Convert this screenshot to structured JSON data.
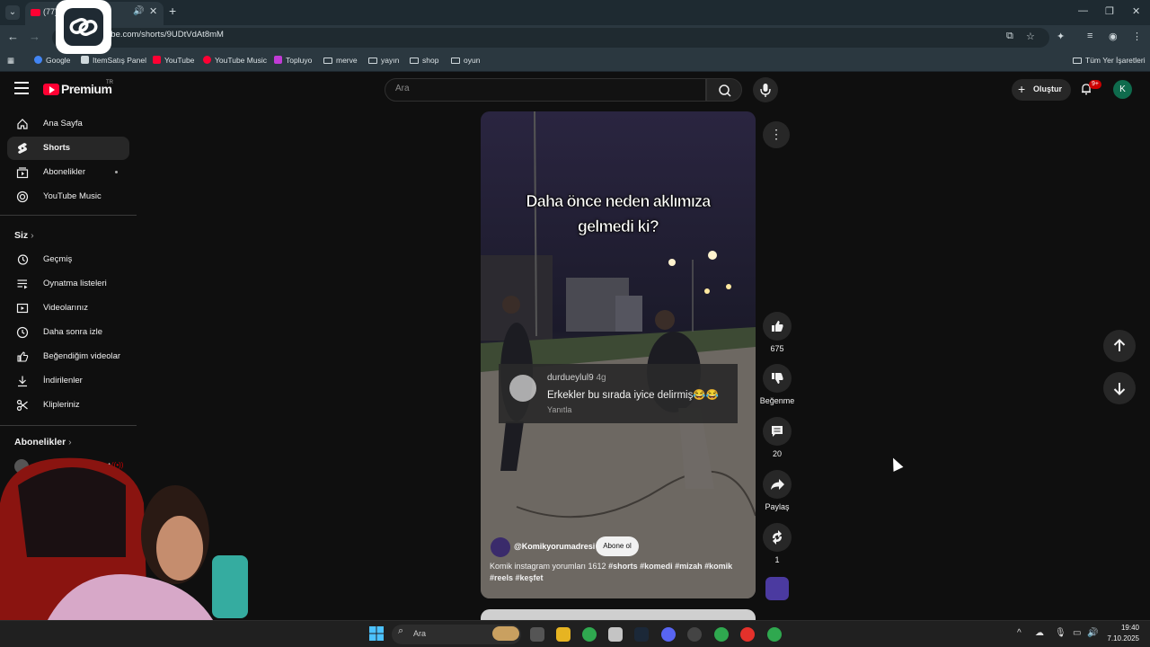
{
  "browser": {
    "tab_title": "(77) yorum",
    "url": "ube.com/shorts/9UDtVdAt8mM",
    "bookmarks": [
      {
        "label": "Google",
        "icon": "google-icon",
        "color": "#4285f4"
      },
      {
        "label": "ItemSatış Panel",
        "icon": "panel-icon",
        "color": "#cfd8dc"
      },
      {
        "label": "YouTube",
        "icon": "youtube-icon",
        "color": "#ff0033"
      },
      {
        "label": "YouTube Music",
        "icon": "youtube-music-icon",
        "color": "#ff0033"
      },
      {
        "label": "Topluyo",
        "icon": "topluyo-icon",
        "color": "#c13bd6"
      },
      {
        "label": "merve",
        "icon": "folder-icon"
      },
      {
        "label": "yayın",
        "icon": "folder-icon"
      },
      {
        "label": "shop",
        "icon": "folder-icon"
      },
      {
        "label": "oyun",
        "icon": "folder-icon"
      }
    ],
    "all_bookmarks": "Tüm Yer İşaretleri"
  },
  "masthead": {
    "brand": "Premium",
    "country": "TR",
    "search_placeholder": "Ara",
    "create_label": "Oluştur",
    "notification_badge": "9+",
    "avatar_letter": "K"
  },
  "sidebar": {
    "main": [
      {
        "label": "Ana Sayfa",
        "icon": "home-icon"
      },
      {
        "label": "Shorts",
        "icon": "shorts-icon"
      },
      {
        "label": "Abonelikler",
        "icon": "subscriptions-icon"
      },
      {
        "label": "YouTube Music",
        "icon": "youtube-music-icon"
      }
    ],
    "you_header": "Siz",
    "you": [
      {
        "label": "Geçmiş",
        "icon": "history-icon"
      },
      {
        "label": "Oynatma listeleri",
        "icon": "playlists-icon"
      },
      {
        "label": "Videolarınız",
        "icon": "your-videos-icon"
      },
      {
        "label": "Daha sonra izle",
        "icon": "watch-later-icon"
      },
      {
        "label": "Beğendiğim videolar",
        "icon": "liked-videos-icon"
      },
      {
        "label": "İndirilenler",
        "icon": "downloads-icon"
      },
      {
        "label": "Klipleriniz",
        "icon": "clips-icon"
      }
    ],
    "subs_header": "Abonelikler",
    "sub_partial": "ARA"
  },
  "short": {
    "caption_line1": "Daha önce neden aklımıza",
    "caption_line2": "gelmedi ki?",
    "comment": {
      "user": "durdueylul9",
      "age": "4g",
      "text": "Erkekler bu sırada iyice delirmiş😂😂",
      "reply": "Yanıtla"
    },
    "channel": "@Komikyorumadresi",
    "subscribe": "Abone ol",
    "desc_plain": "Komik instagram yorumları 1612 ",
    "desc_tags_1": "#shorts #komedi #mizah #komik",
    "desc_tags_2": "#reels #keşfet"
  },
  "actions": {
    "likes": "675",
    "dislike_label": "Beğenme",
    "comments": "20",
    "share_label": "Paylaş",
    "remix_count": "1"
  },
  "taskbar": {
    "search_label": "Ara",
    "time": "19:40",
    "date": "7.10.2025"
  }
}
